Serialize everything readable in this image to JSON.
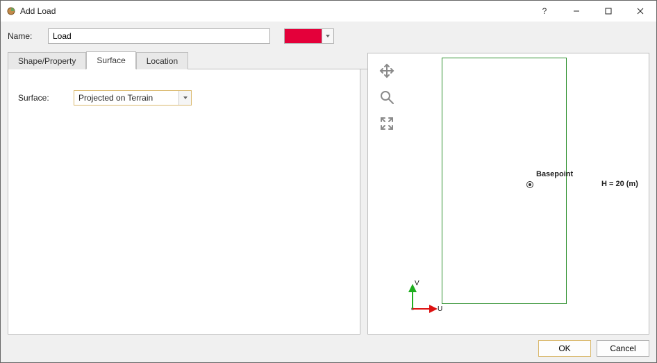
{
  "window": {
    "title": "Add Load",
    "help": "?",
    "minimize": "—",
    "maximize": "▢",
    "close": "✕"
  },
  "name_field": {
    "label": "Name:",
    "value": "Load"
  },
  "color_picker": {
    "selected_hex": "#e4003a"
  },
  "tabs": {
    "shape": "Shape/Property",
    "surface": "Surface",
    "location": "Location",
    "active": "surface"
  },
  "surface_field": {
    "label": "Surface:",
    "selected": "Projected on Terrain"
  },
  "preview": {
    "tools": {
      "pan": "pan-icon",
      "zoom": "zoom-icon",
      "expand": "fit-icon"
    },
    "basepoint_label": "Basepoint",
    "dimension_label": "H = 20 (m)",
    "axis_v": "V",
    "axis_u": "U"
  },
  "buttons": {
    "ok": "OK",
    "cancel": "Cancel"
  }
}
